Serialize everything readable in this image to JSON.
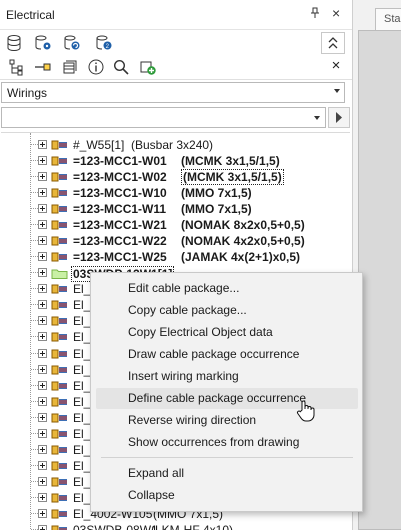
{
  "window": {
    "title": "Electrical",
    "pin_glyph": "⌂",
    "close_glyph": "×"
  },
  "right_pane": {
    "tab_label": "Sta"
  },
  "toolbar": {
    "collapse_glyph": "»",
    "close_glyph": "×"
  },
  "filter": {
    "selected": "Wirings"
  },
  "search": {
    "value": "",
    "placeholder": ""
  },
  "tree": {
    "rows": [
      {
        "name": "#_W55[1]",
        "desc": "(Busbar 3x240)",
        "bold": false
      },
      {
        "name": "=123-MCC1-W01",
        "desc": "(MCMK 3x1,5/1,5)",
        "bold": true
      },
      {
        "name": "=123-MCC1-W02",
        "desc": "(MCMK 3x1,5/1,5)",
        "bold": true,
        "boxed_desc": true
      },
      {
        "name": "=123-MCC1-W10",
        "desc": "(MMO 7x1,5)",
        "bold": true
      },
      {
        "name": "=123-MCC1-W11",
        "desc": "(MMO 7x1,5)",
        "bold": true
      },
      {
        "name": "=123-MCC1-W21",
        "desc": "(NOMAK 8x2x0,5+0,5)",
        "bold": true
      },
      {
        "name": "=123-MCC1-W22",
        "desc": "(NOMAK 4x2x0,5+0,5)",
        "bold": true
      },
      {
        "name": "=123-MCC1-W25",
        "desc": "(JAMAK 4x(2+1)x0,5)",
        "bold": true
      },
      {
        "name": "03SWDP-12W1[1]",
        "desc": "",
        "bold": true,
        "selected": true
      },
      {
        "name": "El_",
        "desc": "",
        "bold": false
      },
      {
        "name": "El_",
        "desc": "",
        "bold": false
      },
      {
        "name": "El_",
        "desc": "",
        "bold": false
      },
      {
        "name": "El_",
        "desc": "",
        "bold": false
      },
      {
        "name": "El_",
        "desc": "",
        "bold": false
      },
      {
        "name": "El_",
        "desc": "",
        "bold": false
      },
      {
        "name": "El_",
        "desc": "",
        "bold": false
      },
      {
        "name": "El_",
        "desc": "",
        "bold": false
      },
      {
        "name": "El_",
        "desc": "",
        "bold": false
      },
      {
        "name": "El_",
        "desc": "",
        "bold": false
      },
      {
        "name": "El_",
        "desc": "",
        "bold": false
      },
      {
        "name": "El_",
        "desc": "",
        "bold": false
      },
      {
        "name": "El_",
        "desc": "",
        "bold": false
      },
      {
        "name": "El_",
        "desc": "",
        "bold": false
      },
      {
        "name": "El_4002-W105",
        "desc": "(MMO 7x1,5)",
        "bold": false
      },
      {
        "name": "03SWDB-08W1",
        "desc": "(LKM-HF 4x10)",
        "bold": false
      }
    ]
  },
  "context_menu": {
    "items": [
      {
        "label": "Edit cable package..."
      },
      {
        "label": "Copy cable package..."
      },
      {
        "label": "Copy Electrical Object data"
      },
      {
        "label": "Draw cable package occurrence"
      },
      {
        "label": "Insert wiring marking"
      },
      {
        "label": "Define cable package occurrence"
      },
      {
        "label": "Reverse wiring direction"
      },
      {
        "label": "Show occurrences from drawing"
      },
      {
        "label": "Expand all"
      },
      {
        "label": "Collapse"
      }
    ],
    "hovered_index": 5
  },
  "colors": {
    "accent": "#2e7d32",
    "hover": "#e4e4e4",
    "icon_blue": "#1e5fa8"
  }
}
